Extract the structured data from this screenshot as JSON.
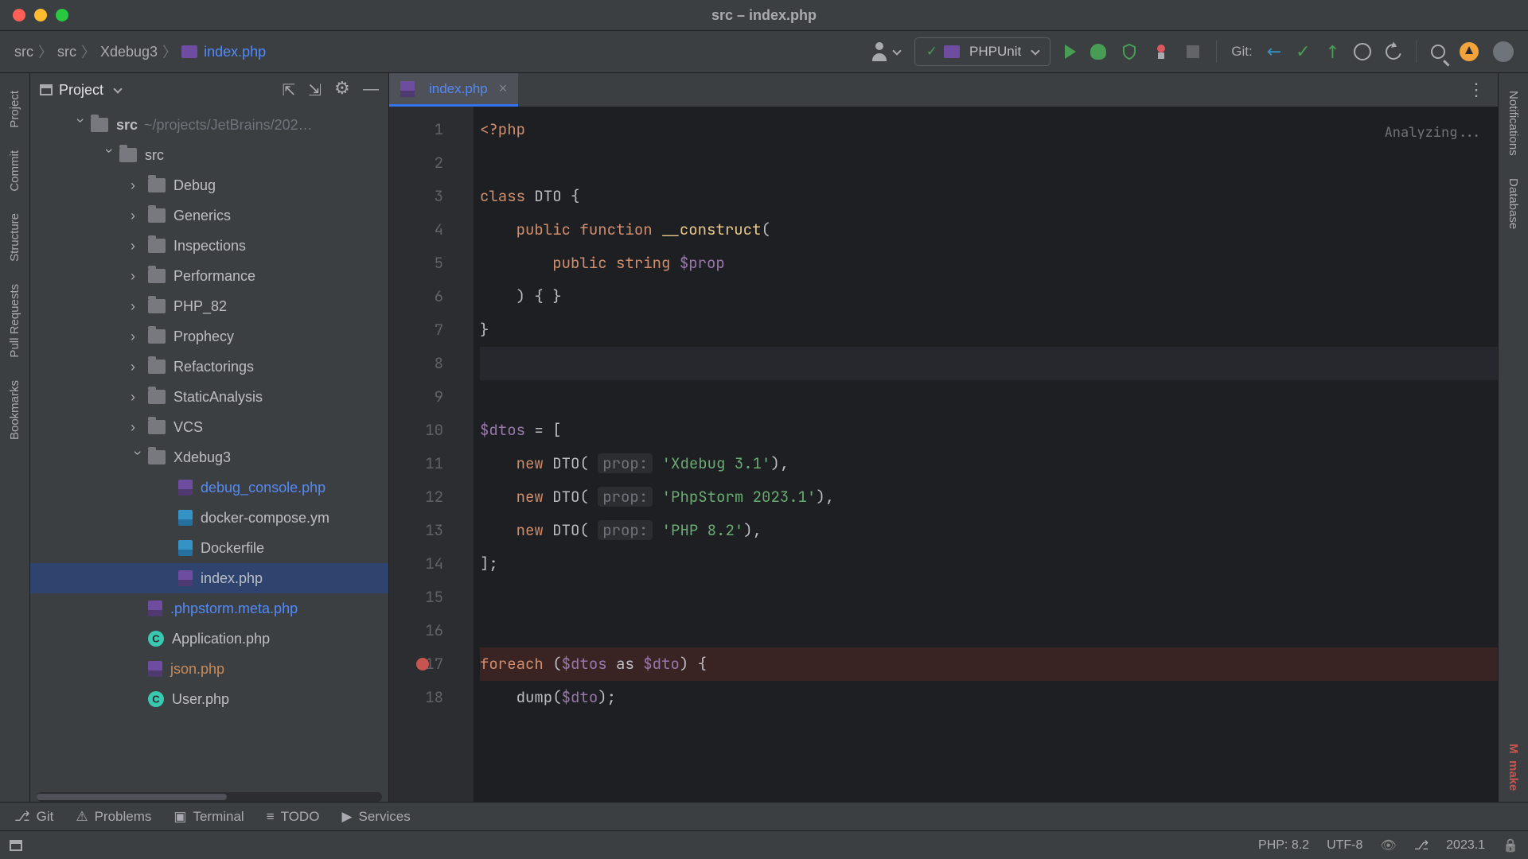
{
  "window": {
    "title": "src – index.php"
  },
  "breadcrumb": {
    "parts": [
      "src",
      "src",
      "Xdebug3"
    ],
    "file": "index.php"
  },
  "toolbar": {
    "run_config": "PHPUnit",
    "git_label": "Git:"
  },
  "project_panel": {
    "title": "Project",
    "root": {
      "name": "src",
      "path": "~/projects/JetBrains/202…"
    },
    "folders": [
      "src",
      "Debug",
      "Generics",
      "Inspections",
      "Performance",
      "PHP_82",
      "Prophecy",
      "Refactorings",
      "StaticAnalysis",
      "VCS",
      "Xdebug3"
    ],
    "xdebug_files": [
      "debug_console.php",
      "docker-compose.ym",
      "Dockerfile",
      "index.php"
    ],
    "root_files": [
      ".phpstorm.meta.php",
      "Application.php",
      "json.php",
      "User.php"
    ]
  },
  "tabs": {
    "active": "index.php"
  },
  "editor": {
    "analyzing": "Analyzing...",
    "lines": [
      1,
      2,
      3,
      4,
      5,
      6,
      7,
      8,
      9,
      10,
      11,
      12,
      13,
      14,
      15,
      16,
      17,
      18
    ],
    "code": {
      "l1_open": "<?php",
      "l3_class": "class",
      "l3_name": "DTO",
      "l3_brace": " {",
      "l4_pub": "public",
      "l4_fn": "function",
      "l4_name": "__construct",
      "l4_paren": "(",
      "l5_pub": "public",
      "l5_type": "string",
      "l5_var": "$prop",
      "l6": ") { }",
      "l7": "}",
      "l10_var": "$dtos",
      "l10_rest": " = [",
      "l11_new": "new",
      "l11_cls": "DTO",
      "l11_hint": "prop:",
      "l11_str": "'Xdebug 3.1'",
      "l11_end": "),",
      "l12_new": "new",
      "l12_cls": "DTO",
      "l12_hint": "prop:",
      "l12_str": "'PhpStorm 2023.1'",
      "l12_end": "),",
      "l13_new": "new",
      "l13_cls": "DTO",
      "l13_hint": "prop:",
      "l13_str": "'PHP 8.2'",
      "l13_end": "),",
      "l14": "];",
      "l17_foreach": "foreach",
      "l17_open": " (",
      "l17_v1": "$dtos",
      "l17_as": " as ",
      "l17_v2": "$dto",
      "l17_close": ") {",
      "l18_fn": "dump",
      "l18_open": "(",
      "l18_v": "$dto",
      "l18_close": ");"
    }
  },
  "tool_windows": {
    "git": "Git",
    "problems": "Problems",
    "terminal": "Terminal",
    "todo": "TODO",
    "services": "Services"
  },
  "status": {
    "php": "PHP: 8.2",
    "enc": "UTF-8",
    "ver": "2023.1"
  },
  "right_rail": {
    "notifications": "Notifications",
    "database": "Database",
    "make": "make"
  },
  "left_rail": {
    "project": "Project",
    "commit": "Commit",
    "structure": "Structure",
    "pull_requests": "Pull Requests",
    "bookmarks": "Bookmarks"
  }
}
